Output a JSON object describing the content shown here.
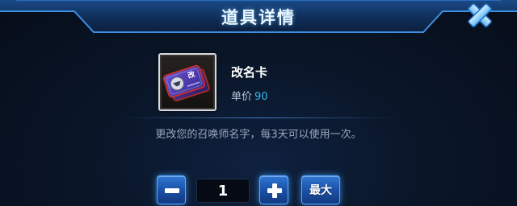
{
  "dialog": {
    "title": "道具详情"
  },
  "item": {
    "name": "改名卡",
    "price_label": "单价",
    "price_value": "90",
    "icon_char": "改",
    "description": "更改您的召唤师名字，每3天可以使用一次。"
  },
  "quantity": {
    "value": "1",
    "max_label": "最大"
  },
  "colors": {
    "accent": "#37b8ee",
    "button": "#2560c0",
    "header": "#0f2c56"
  },
  "icons": {
    "close": "close-x-icon",
    "minus": "minus-icon",
    "plus": "plus-icon",
    "item": "rename-card-icon"
  }
}
